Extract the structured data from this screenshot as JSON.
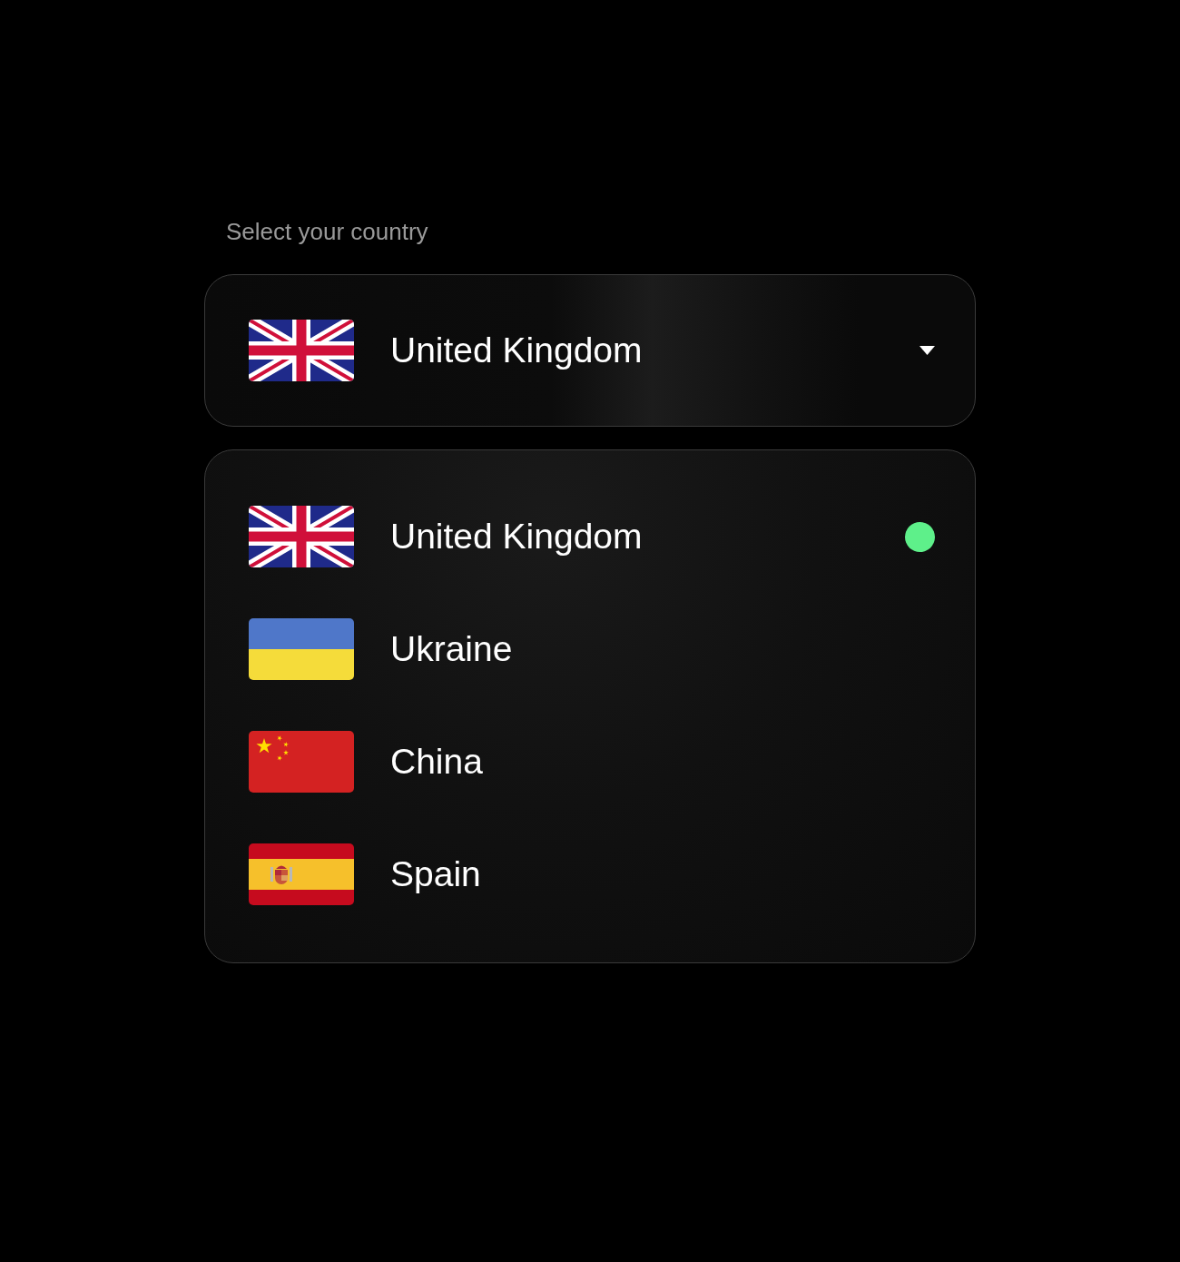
{
  "label": "Select your country",
  "select": {
    "value": "United Kingdom",
    "kind": "uk",
    "expanded": true
  },
  "options": [
    {
      "name": "United Kingdom",
      "kind": "uk",
      "selected": true
    },
    {
      "name": "Ukraine",
      "kind": "ukraine",
      "selected": false
    },
    {
      "name": "China",
      "kind": "china",
      "selected": false
    },
    {
      "name": "Spain",
      "kind": "spain",
      "selected": false
    }
  ]
}
